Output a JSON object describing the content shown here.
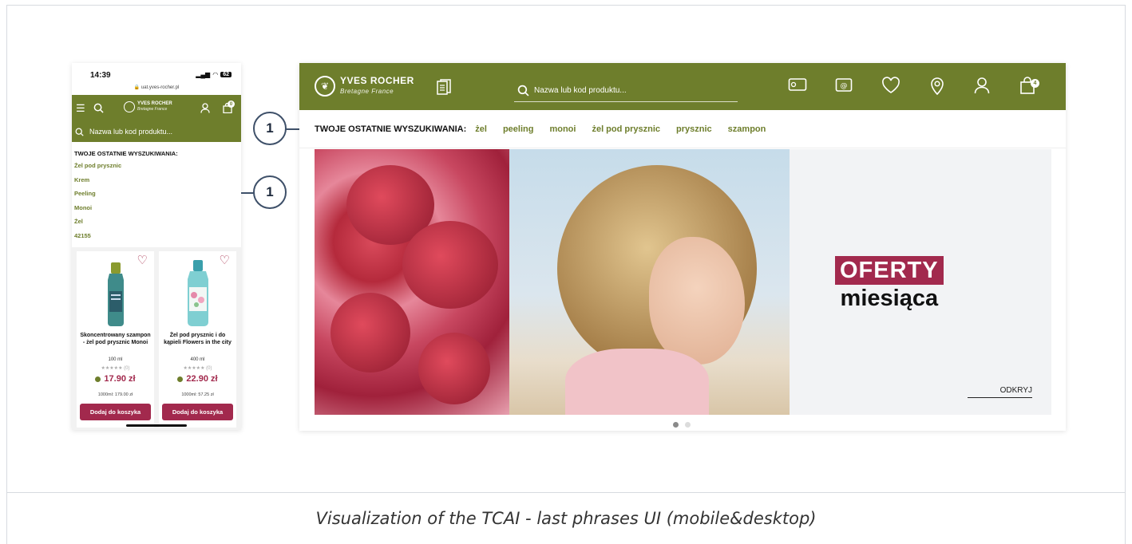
{
  "caption": "Visualization of the TCAI - last phrases UI (mobile&desktop)",
  "callout_number": "1",
  "colors": {
    "brand_green": "#6e7e2c",
    "accent_pink": "#a2294d",
    "callout_border": "#3e5069"
  },
  "mobile": {
    "status": {
      "time": "14:39",
      "url": "uat.yves-rocher.pl",
      "battery": "62"
    },
    "brand": {
      "name": "YVES ROCHER",
      "tagline": "Bretagne France"
    },
    "cart_count": "0",
    "search_placeholder": "Nazwa lub kod produktu...",
    "recent_title": "TWOJE OSTATNIE WYSZUKIWANIA:",
    "recent": [
      "Żel pod prysznic",
      "Krem",
      "Peeling",
      "Monoi",
      "Żel",
      "42155"
    ],
    "products": [
      {
        "name": "Skoncentrowany szampon - żel pod prysznic Monoi",
        "size": "100 ml",
        "rating": "★★★★★ (0)",
        "price": "17.90 zł",
        "unit_price": "1000ml: 179.00 zł",
        "add_label": "Dodaj do koszyka"
      },
      {
        "name": "Żel pod prysznic i do kąpieli Flowers in the city",
        "size": "400 ml",
        "rating": "★★★★★ (0)",
        "price": "22.90 zł",
        "unit_price": "1000ml: 57.25 zł",
        "add_label": "Dodaj do koszyka"
      }
    ],
    "icons": [
      "menu-icon",
      "search-icon",
      "user-icon",
      "bag-icon",
      "heart-icon"
    ]
  },
  "desktop": {
    "brand": {
      "name": "YVES ROCHER",
      "tagline": "Bretagne France"
    },
    "search_placeholder": "Nazwa lub kod produktu...",
    "cart_count": "4",
    "recent_title": "TWOJE OSTATNIE WYSZUKIWANIA:",
    "recent": [
      "żel",
      "peeling",
      "monoi",
      "żel pod prysznic",
      "prysznic",
      "szampon"
    ],
    "hero": {
      "tag": "OFERTY",
      "headline": "miesiąca",
      "cta": "ODKRYJ"
    },
    "carousel": {
      "count": 2,
      "active": 1
    },
    "icons": [
      "catalog-icon",
      "gift-card-icon",
      "newsletter-icon",
      "wishlist-icon",
      "store-locator-icon",
      "account-icon",
      "bag-icon"
    ]
  }
}
